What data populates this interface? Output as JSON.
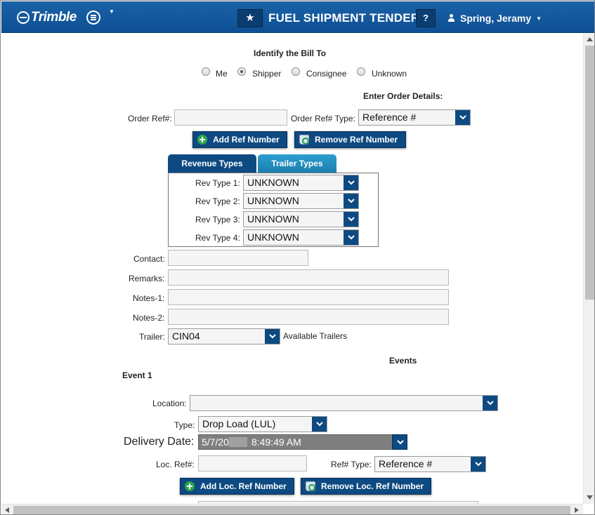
{
  "header": {
    "logo": "Trimble",
    "title": "FUEL SHIPMENT TENDER",
    "help_label": "?",
    "user_name": "Spring, Jeramy",
    "colors": {
      "bar": "#0e4f93",
      "button": "#0e4a82"
    }
  },
  "bill_to": {
    "heading": "Identify the Bill To",
    "options": [
      "Me",
      "Shipper",
      "Consignee",
      "Unknown"
    ],
    "selected": "Shipper"
  },
  "order_details": {
    "heading": "Enter Order Details:",
    "ref_label": "Order Ref#:",
    "ref_value": "",
    "ref_type_label": "Order Ref# Type:",
    "ref_type_value": "Reference #",
    "add_button": "Add Ref Number",
    "remove_button": "Remove Ref Number"
  },
  "tabs": {
    "items": [
      "Revenue Types",
      "Trailer Types"
    ],
    "active": "Revenue Types",
    "rev_types": [
      {
        "label": "Rev Type 1:",
        "value": "UNKNOWN"
      },
      {
        "label": "Rev Type 2:",
        "value": "UNKNOWN"
      },
      {
        "label": "Rev Type 3:",
        "value": "UNKNOWN"
      },
      {
        "label": "Rev Type 4:",
        "value": "UNKNOWN"
      }
    ]
  },
  "fields": {
    "contact_label": "Contact:",
    "remarks_label": "Remarks:",
    "notes1_label": "Notes-1:",
    "notes2_label": "Notes-2:",
    "trailer_label": "Trailer:",
    "trailer_value": "CIN04",
    "available_trailers": "Available Trailers"
  },
  "events": {
    "heading": "Events",
    "event_title": "Event 1",
    "location_label": "Location:",
    "location_value": "",
    "type_label": "Type:",
    "type_value": "Drop Load (LUL)",
    "delivery_label": "Delivery Date:",
    "delivery_value_start": "5/7/20",
    "delivery_value_end": "8:49:49 AM",
    "loc_ref_label": "Loc. Ref#:",
    "loc_ref_value": "",
    "ref_type_label": "Ref# Type:",
    "ref_type_value": "Reference #",
    "add_button": "Add Loc. Ref Number",
    "remove_button": "Remove Loc. Ref Number"
  }
}
